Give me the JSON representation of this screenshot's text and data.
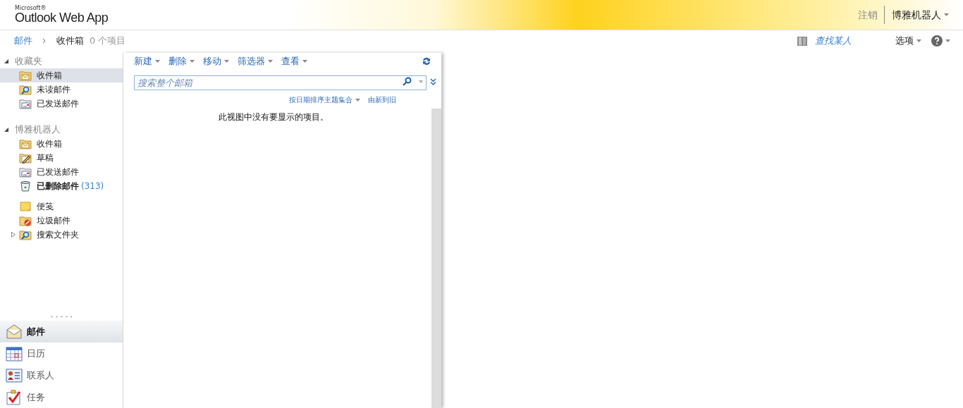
{
  "header": {
    "logo_small": "Microsoft®",
    "logo": "Outlook Web App",
    "sign_out": "注销",
    "user": "博雅机器人"
  },
  "breadcrumb": {
    "parent": "邮件",
    "current": "收件箱",
    "count": "0 个项目"
  },
  "top_links": {
    "find_people": "查找某人",
    "options": "选项"
  },
  "folder_groups": [
    {
      "label": "收藏夹",
      "expanded": true,
      "sections": [
        [
          {
            "label": "收件箱",
            "kind": "inbox",
            "selected": true
          },
          {
            "label": "未读邮件",
            "kind": "search",
            "selected": false
          },
          {
            "label": "已发送邮件",
            "kind": "sent",
            "selected": false
          }
        ]
      ]
    },
    {
      "label": "博雅机器人",
      "expanded": true,
      "sections": [
        [
          {
            "label": "收件箱",
            "kind": "inbox",
            "selected": false
          },
          {
            "label": "草稿",
            "kind": "drafts",
            "selected": false
          },
          {
            "label": "已发送邮件",
            "kind": "sent",
            "selected": false
          },
          {
            "label": "已删除邮件",
            "kind": "deleted",
            "selected": false,
            "count": "(313)"
          }
        ],
        [
          {
            "label": "便笺",
            "kind": "notes",
            "selected": false
          },
          {
            "label": "垃圾邮件",
            "kind": "junk",
            "selected": false
          },
          {
            "label": "搜索文件夹",
            "kind": "search",
            "selected": false,
            "expanded": false
          }
        ]
      ]
    }
  ],
  "modules": [
    {
      "label": "邮件",
      "kind": "mail",
      "selected": true
    },
    {
      "label": "日历",
      "kind": "calendar",
      "selected": false
    },
    {
      "label": "联系人",
      "kind": "contacts",
      "selected": false
    },
    {
      "label": "任务",
      "kind": "tasks",
      "selected": false
    }
  ],
  "toolbar": [
    "新建",
    "删除",
    "移动",
    "筛选器",
    "查看"
  ],
  "search": {
    "placeholder": "搜索整个邮箱"
  },
  "sort": {
    "arrange": "按日期排序主题集合",
    "order": "由新到旧"
  },
  "empty_message": "此视图中没有要显示的项目。"
}
